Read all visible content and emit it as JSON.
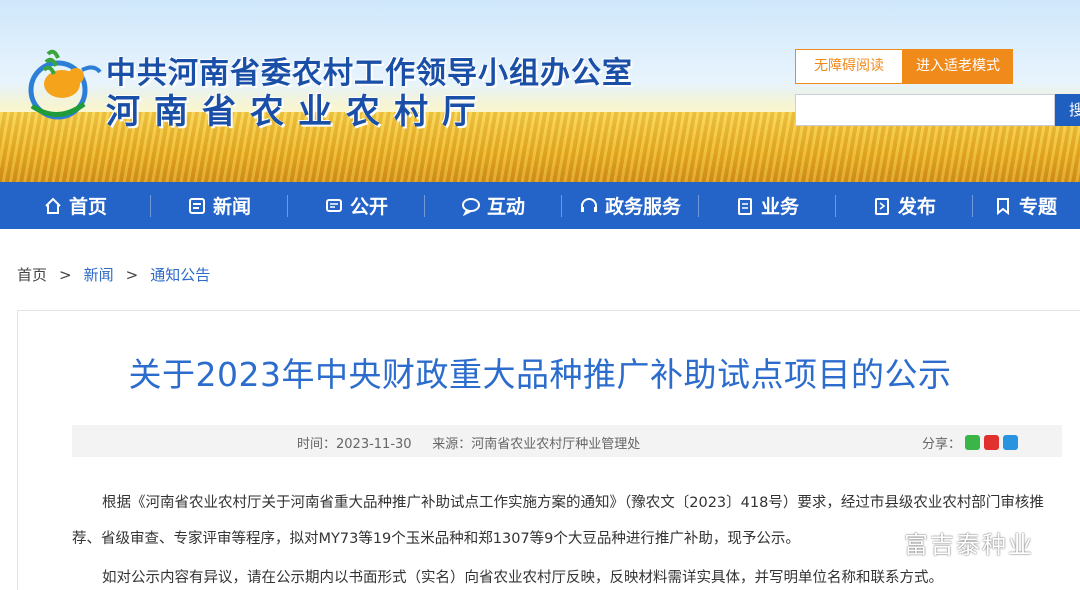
{
  "header": {
    "org_title": "中共河南省委农村工作领导小组办公室",
    "dept_title": "河南省农业农村厅",
    "accessibility_label": "无障碍阅读",
    "elder_mode_label": "进入适老模式",
    "search_placeholder": "",
    "search_button": "搜"
  },
  "nav": {
    "items": [
      {
        "label": "首页",
        "icon": "home-icon"
      },
      {
        "label": "新闻",
        "icon": "news-icon"
      },
      {
        "label": "公开",
        "icon": "open-icon"
      },
      {
        "label": "互动",
        "icon": "chat-icon"
      },
      {
        "label": "政务服务",
        "icon": "headset-icon"
      },
      {
        "label": "业务",
        "icon": "clipboard-icon"
      },
      {
        "label": "发布",
        "icon": "publish-icon"
      },
      {
        "label": "专题",
        "icon": "bookmark-icon"
      }
    ]
  },
  "breadcrumb": {
    "items": [
      "首页",
      "新闻",
      "通知公告"
    ],
    "separator": ">"
  },
  "article": {
    "title": "关于2023年中央财政重大品种推广补助试点项目的公示",
    "time_label": "时间：2023-11-30",
    "source_label": "来源：河南省农业农村厅种业管理处",
    "share_label": "分享：",
    "paragraph_1": "根据《河南省农业农村厅关于河南省重大品种推广补助试点工作实施方案的通知》（豫农文〔2023〕418号）要求，经过市县级农业农村部门审核推荐、省级审查、专家评审等程序，拟对MY73等19个玉米品种和郑1307等9个大豆品种进行推广补助，现予公示。",
    "paragraph_2": "如对公示内容有异议，请在公示期内以书面形式（实名）向省农业农村厅反映，反映材料需详实具体，并写明单位名称和联系方式。"
  },
  "watermark": {
    "text": "富吉泰种业",
    "icon": "wechat-icon"
  },
  "colors": {
    "nav_bg": "#2464c8",
    "title_blue": "#2b6ccc",
    "accent_orange": "#f08a1b"
  }
}
